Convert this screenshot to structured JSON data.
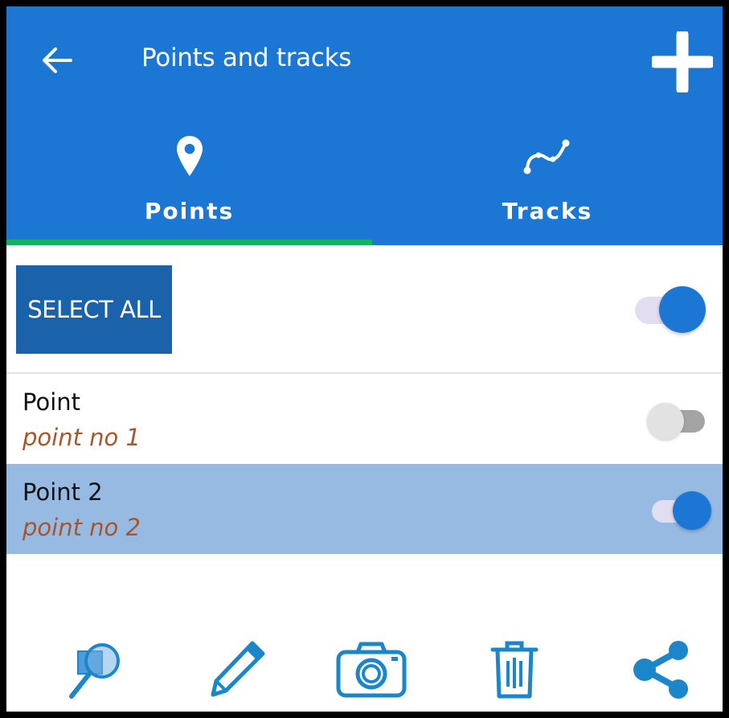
{
  "header": {
    "title": "Points and tracks",
    "back_icon": "arrow-left-icon",
    "add_icon": "plus-icon"
  },
  "tabs": [
    {
      "label": "Points",
      "icon": "map-pin-icon",
      "selected": true
    },
    {
      "label": "Tracks",
      "icon": "track-line-icon",
      "selected": false
    }
  ],
  "select_all": {
    "label": "SELECT ALL",
    "toggle_on": true
  },
  "list": {
    "items": [
      {
        "name": "Point",
        "description": "point no 1",
        "visible": false,
        "highlighted": false
      },
      {
        "name": "Point 2",
        "description": "point no 2",
        "visible": true,
        "highlighted": true
      }
    ]
  },
  "toolbar": {
    "icons": [
      "zoom-to-icon",
      "edit-pencil-icon",
      "camera-icon",
      "trash-icon",
      "share-icon"
    ]
  },
  "colors": {
    "primary": "#1c77d4",
    "tab_indicator": "#14b35d",
    "select_all_bg": "#1a63aa",
    "highlight_row": "#97bae3",
    "description_text": "#a5572b",
    "toolbar_icon": "#1b86c9"
  }
}
